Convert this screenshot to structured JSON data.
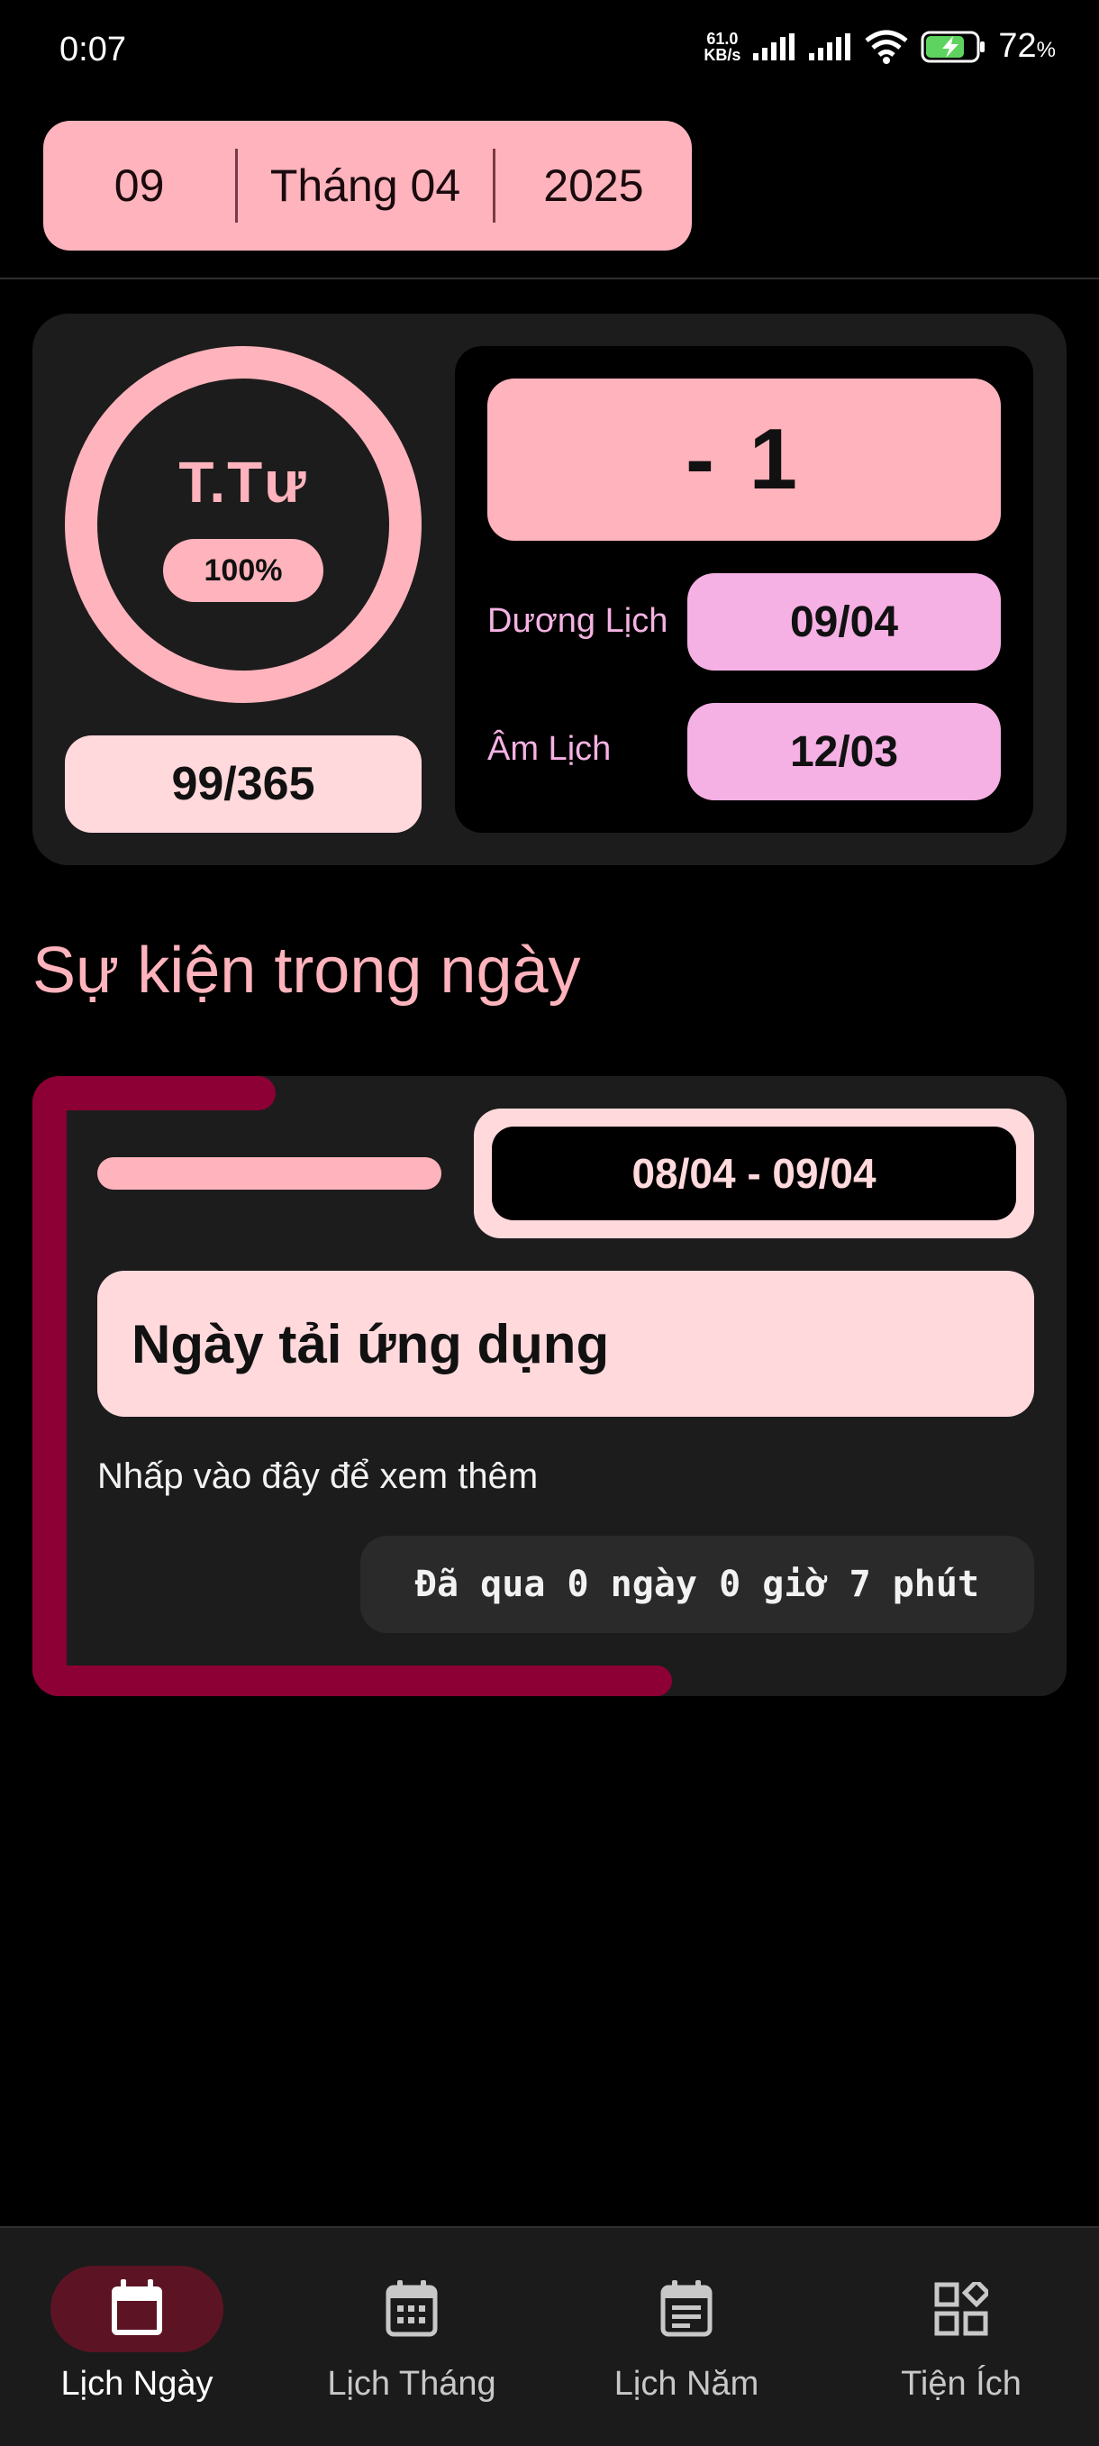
{
  "status_bar": {
    "time": "0:07",
    "net_speed_value": "61.0",
    "net_speed_unit": "KB/s",
    "battery_percent": "72",
    "battery_unit": "%"
  },
  "date_picker": {
    "day": "09",
    "month": "Tháng 04",
    "year": "2025"
  },
  "summary": {
    "weekday": "T.Tư",
    "progress": "100%",
    "day_of_year": "99/365",
    "countdown": "- 1",
    "solar_label": "Dương Lịch",
    "solar_date": "09/04",
    "lunar_label": "Âm Lịch",
    "lunar_date": "12/03"
  },
  "events_section": {
    "title": "Sự kiện trong ngày",
    "events": [
      {
        "date_range": "08/04 - 09/04",
        "title": "Ngày tải ứng dụng",
        "hint": "Nhấp vào đây để xem thêm",
        "elapsed": "Đã qua 0 ngày 0 giờ 7 phút"
      }
    ]
  },
  "bottom_nav": {
    "items": [
      {
        "label": "Lịch Ngày",
        "icon": "calendar-icon",
        "active": true
      },
      {
        "label": "Lịch Tháng",
        "icon": "calendar-month-icon",
        "active": false
      },
      {
        "label": "Lịch Năm",
        "icon": "calendar-year-icon",
        "active": false
      },
      {
        "label": "Tiện Ích",
        "icon": "widgets-icon",
        "active": false
      }
    ]
  },
  "colors": {
    "accent_pink": "#ffb3bc",
    "light_pink": "#ffd9dc",
    "lilac": "#f5b0e4",
    "event_accent": "#8c0035",
    "nav_active_bg": "#5c1424"
  }
}
